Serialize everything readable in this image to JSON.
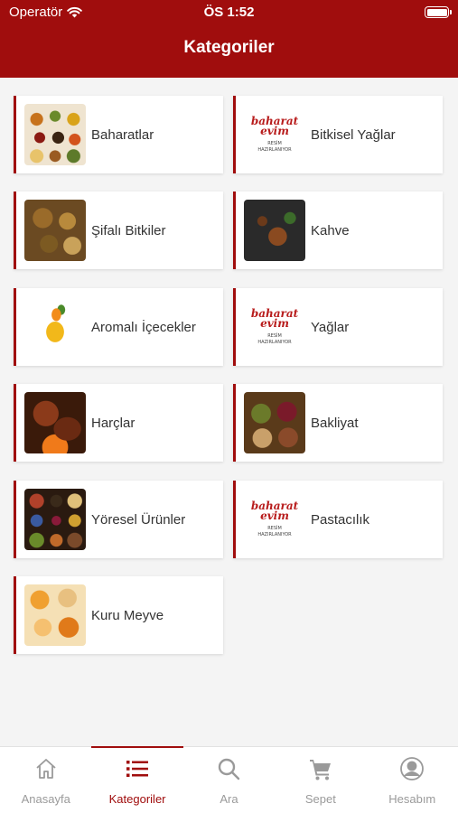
{
  "status_bar": {
    "carrier": "Operatör",
    "time": "ÖS 1:52"
  },
  "header": {
    "title": "Kategoriler"
  },
  "logo": {
    "line1": "baharat",
    "line2": "evim",
    "caption_line1": "RESİM",
    "caption_line2": "HAZIRLANIYOR"
  },
  "categories": [
    {
      "label": "Baharatlar",
      "thumb": "spices-photo"
    },
    {
      "label": "Bitkisel Yağlar",
      "thumb": "placeholder-logo"
    },
    {
      "label": "Şifalı Bitkiler",
      "thumb": "herbs-photo"
    },
    {
      "label": "Kahve",
      "thumb": "coffee-photo"
    },
    {
      "label": "Aromalı İçecekler",
      "thumb": "drink-photo"
    },
    {
      "label": "Yağlar",
      "thumb": "placeholder-logo"
    },
    {
      "label": "Harçlar",
      "thumb": "meat-photo"
    },
    {
      "label": "Bakliyat",
      "thumb": "legumes-photo"
    },
    {
      "label": "Yöresel Ürünler",
      "thumb": "local-products-photo"
    },
    {
      "label": "Pastacılık",
      "thumb": "placeholder-logo"
    },
    {
      "label": "Kuru Meyve",
      "thumb": "dried-fruit-photo"
    }
  ],
  "tabbar": {
    "items": [
      {
        "label": "Anasayfa",
        "icon": "home-icon",
        "active": false
      },
      {
        "label": "Kategoriler",
        "icon": "list-icon",
        "active": true
      },
      {
        "label": "Ara",
        "icon": "search-icon",
        "active": false
      },
      {
        "label": "Sepet",
        "icon": "cart-icon",
        "active": false
      },
      {
        "label": "Hesabım",
        "icon": "account-icon",
        "active": false
      }
    ]
  },
  "colors": {
    "brand": "#a00d0d",
    "background": "#f4f4f4",
    "tab_inactive": "#9a9a9a"
  }
}
